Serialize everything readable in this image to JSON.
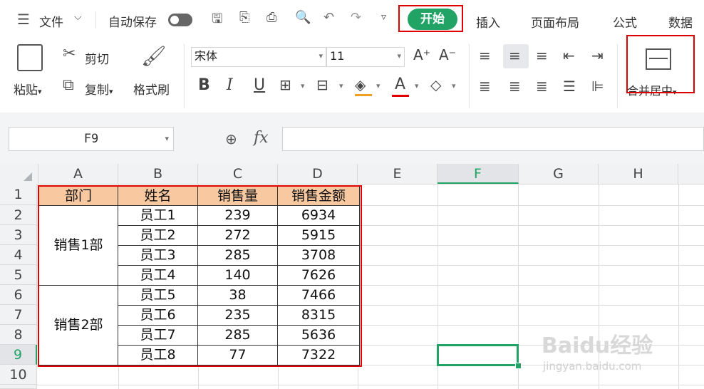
{
  "menu": {
    "file_label": "文件",
    "autosave_label": "自动保存",
    "tabs": [
      "开始",
      "插入",
      "页面布局",
      "公式",
      "数据"
    ]
  },
  "ribbon": {
    "paste": "粘贴",
    "cut": "剪切",
    "copy": "复制",
    "format_painter": "格式刷",
    "font_name": "宋体",
    "font_size": "11",
    "bold": "B",
    "italic": "I",
    "underline": "U",
    "font_color_letter": "A",
    "merge_center": "合并居中"
  },
  "formula_bar": {
    "name_box": "F9",
    "fx": "fx",
    "formula": ""
  },
  "grid": {
    "columns": [
      "A",
      "B",
      "C",
      "D",
      "E",
      "F",
      "G",
      "H"
    ],
    "rows": [
      "1",
      "2",
      "3",
      "4",
      "5",
      "6",
      "7",
      "8",
      "9",
      "10"
    ],
    "selected_cell": "F9",
    "selected_column": "F",
    "selected_row": "9"
  },
  "table": {
    "headers": [
      "部门",
      "姓名",
      "销售量",
      "销售金额"
    ],
    "groups": [
      {
        "dept": "销售1部",
        "rows": [
          [
            "员工1",
            "239",
            "6934"
          ],
          [
            "员工2",
            "272",
            "5915"
          ],
          [
            "员工3",
            "285",
            "3708"
          ],
          [
            "员工4",
            "140",
            "7626"
          ]
        ]
      },
      {
        "dept": "销售2部",
        "rows": [
          [
            "员工5",
            "38",
            "7466"
          ],
          [
            "员工6",
            "235",
            "8315"
          ],
          [
            "员工7",
            "285",
            "5636"
          ],
          [
            "员工8",
            "77",
            "7322"
          ]
        ]
      }
    ]
  },
  "watermark": {
    "brand": "Baidu经验",
    "url": "jingyan.baidu.com"
  },
  "colors": {
    "accent": "#21a366",
    "highlight_red": "#e00000",
    "header_fill": "#f8c9a0"
  }
}
